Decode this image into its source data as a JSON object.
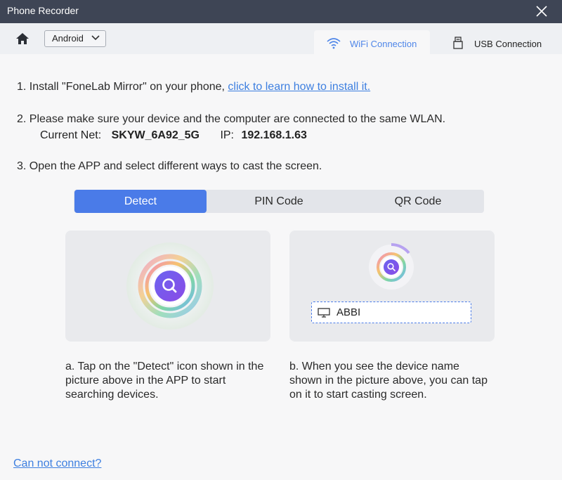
{
  "window": {
    "title": "Phone Recorder"
  },
  "toolbar": {
    "os_select": {
      "value": "Android"
    },
    "tabs": [
      {
        "label": "WiFi Connection",
        "icon": "wifi-icon",
        "active": true
      },
      {
        "label": "USB Connection",
        "icon": "usb-icon",
        "active": false
      }
    ]
  },
  "steps": {
    "step1_text": "1. Install \"FoneLab Mirror\" on your phone, ",
    "step1_link": "click to learn how to install it.",
    "step2_text": "2. Please make sure your device and the computer are connected to the same WLAN.",
    "current_net_label": "Current Net:",
    "current_net_value": "SKYW_6A92_5G",
    "ip_label": "IP:",
    "ip_value": "192.168.1.63",
    "step3_text": "3. Open the APP and select different ways to cast the screen."
  },
  "method_tabs": [
    {
      "label": "Detect",
      "active": true
    },
    {
      "label": "PIN Code",
      "active": false
    },
    {
      "label": "QR Code",
      "active": false
    }
  ],
  "cards": {
    "device_name": "ABBI",
    "desc_a": "a. Tap on the \"Detect\" icon shown in the picture above in the APP to start searching devices.",
    "desc_b": "b. When you see the device name shown in the picture above, you can tap on it to start casting screen."
  },
  "footer": {
    "help_link": "Can not connect?"
  },
  "colors": {
    "titlebar": "#3e4555",
    "accent": "#4a7be8",
    "link": "#3d7fe0",
    "background": "#f7f7f8"
  }
}
